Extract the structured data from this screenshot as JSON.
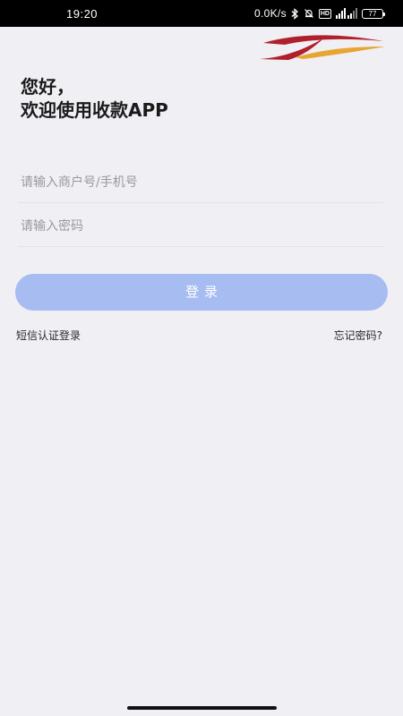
{
  "status_bar": {
    "time": "19:20",
    "network_speed": "0.0K/s",
    "battery_level": "77",
    "hd_label": "HD",
    "icons": [
      "bluetooth-icon",
      "alarm-off-icon",
      "hd-badge-icon",
      "signal-icon",
      "battery-icon"
    ]
  },
  "header": {
    "logo_icon": "brand-logo-icon",
    "colors": {
      "logo_red": "#b0202c",
      "logo_gold": "#e7a532"
    }
  },
  "greeting": {
    "line1": "您好，",
    "line2": "欢迎使用收款APP"
  },
  "login_form": {
    "account_placeholder": "请输入商户号/手机号",
    "account_value": "",
    "password_placeholder": "请输入密码",
    "password_value": "",
    "login_button_label": "登录"
  },
  "links": {
    "sms_login": "短信认证登录",
    "forgot_password": "忘记密码?"
  },
  "colors": {
    "background": "#f0eff4",
    "button": "#a7bcf1",
    "button_text": "#ffffff"
  }
}
